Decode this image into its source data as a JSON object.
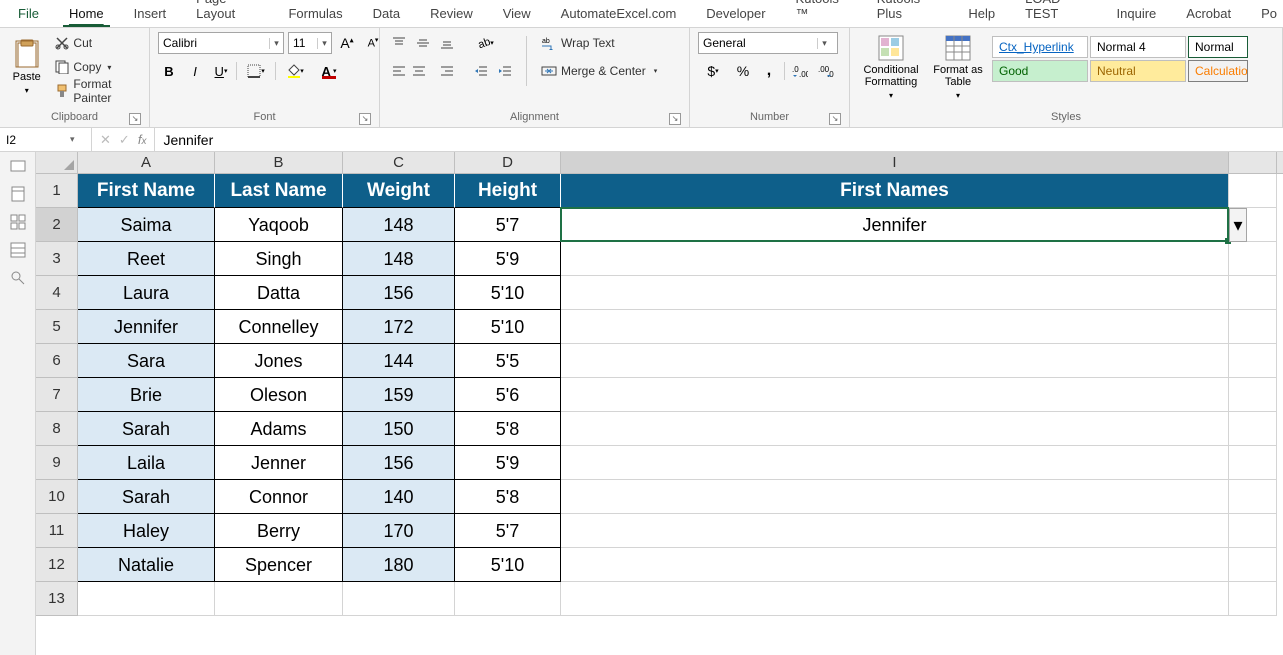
{
  "tabs": {
    "file": "File",
    "home": "Home",
    "insert": "Insert",
    "pageLayout": "Page Layout",
    "formulas": "Formulas",
    "data": "Data",
    "review": "Review",
    "view": "View",
    "automate": "AutomateExcel.com",
    "developer": "Developer",
    "kutools": "Kutools ™",
    "kutoolsPlus": "Kutools Plus",
    "help": "Help",
    "loadTest": "LOAD TEST",
    "inquire": "Inquire",
    "acrobat": "Acrobat",
    "po": "Po"
  },
  "clipboard": {
    "paste": "Paste",
    "cut": "Cut",
    "copy": "Copy",
    "formatPainter": "Format Painter",
    "label": "Clipboard"
  },
  "font": {
    "name": "Calibri",
    "size": "11",
    "label": "Font"
  },
  "alignment": {
    "wrap": "Wrap Text",
    "merge": "Merge & Center",
    "label": "Alignment"
  },
  "number": {
    "format": "General",
    "label": "Number"
  },
  "stylesGroup": {
    "conditional": "Conditional Formatting",
    "formatTable": "Format as Table",
    "link": "Ctx_Hyperlink",
    "normal4": "Normal 4",
    "normal": "Normal",
    "good": "Good",
    "neutral": "Neutral",
    "calc": "Calculatio",
    "label": "Styles"
  },
  "formulaBar": {
    "cellRef": "I2",
    "value": "Jennifer"
  },
  "columns": {
    "A": "A",
    "B": "B",
    "C": "C",
    "D": "D",
    "I": "I"
  },
  "headerRow": {
    "A": "First Name",
    "B": "Last Name",
    "C": "Weight",
    "D": "Height",
    "I": "First Names"
  },
  "rows": [
    {
      "n": "2",
      "a": "Saima",
      "b": "Yaqoob",
      "c": "148",
      "d": "5'7",
      "i": "Jennifer"
    },
    {
      "n": "3",
      "a": "Reet",
      "b": "Singh",
      "c": "148",
      "d": "5'9",
      "i": ""
    },
    {
      "n": "4",
      "a": "Laura",
      "b": "Datta",
      "c": "156",
      "d": "5'10",
      "i": ""
    },
    {
      "n": "5",
      "a": "Jennifer",
      "b": "Connelley",
      "c": "172",
      "d": "5'10",
      "i": ""
    },
    {
      "n": "6",
      "a": "Sara",
      "b": "Jones",
      "c": "144",
      "d": "5'5",
      "i": ""
    },
    {
      "n": "7",
      "a": "Brie",
      "b": "Oleson",
      "c": "159",
      "d": "5'6",
      "i": ""
    },
    {
      "n": "8",
      "a": "Sarah",
      "b": "Adams",
      "c": "150",
      "d": "5'8",
      "i": ""
    },
    {
      "n": "9",
      "a": "Laila",
      "b": "Jenner",
      "c": "156",
      "d": "5'9",
      "i": ""
    },
    {
      "n": "10",
      "a": "Sarah",
      "b": "Connor",
      "c": "140",
      "d": "5'8",
      "i": ""
    },
    {
      "n": "11",
      "a": "Haley",
      "b": "Berry",
      "c": "170",
      "d": "5'7",
      "i": ""
    },
    {
      "n": "12",
      "a": "Natalie",
      "b": "Spencer",
      "c": "180",
      "d": "5'10",
      "i": ""
    },
    {
      "n": "13",
      "a": "",
      "b": "",
      "c": "",
      "d": "",
      "i": ""
    }
  ]
}
